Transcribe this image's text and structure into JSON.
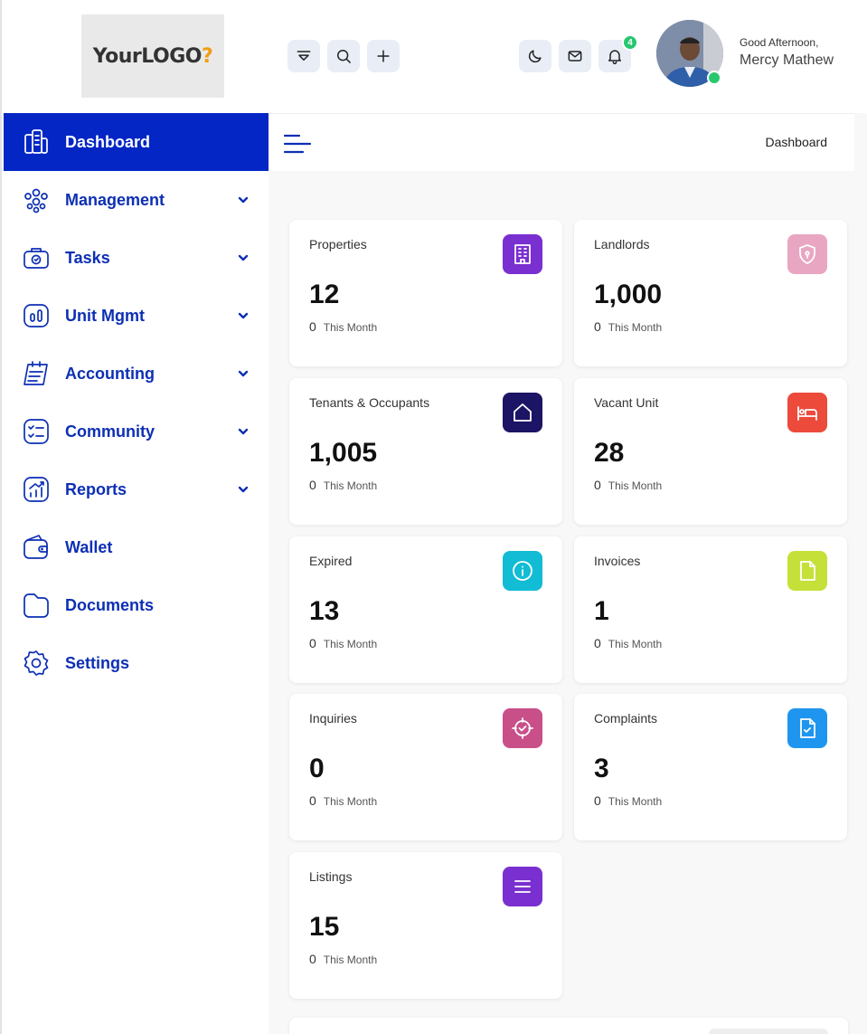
{
  "header": {
    "logo": {
      "part1": "Your",
      "part2": "LOGO",
      "part3": "?"
    },
    "buttons": [
      {
        "name": "filter-icon"
      },
      {
        "name": "search-icon"
      },
      {
        "name": "plus-icon"
      },
      {
        "name": "moon-icon"
      },
      {
        "name": "mail-icon"
      },
      {
        "name": "bell-icon"
      }
    ],
    "notification_count": "4",
    "greeting": "Good Afternoon,",
    "user_name": "Mercy Mathew"
  },
  "sidebar": {
    "items": [
      {
        "label": "Dashboard",
        "icon": "dashboard-icon",
        "active": true,
        "has_children": false
      },
      {
        "label": "Management",
        "icon": "people-icon",
        "active": false,
        "has_children": true
      },
      {
        "label": "Tasks",
        "icon": "briefcase-icon",
        "active": false,
        "has_children": true
      },
      {
        "label": "Unit Mgmt",
        "icon": "unit-icon",
        "active": false,
        "has_children": true
      },
      {
        "label": "Accounting",
        "icon": "ledger-icon",
        "active": false,
        "has_children": true
      },
      {
        "label": "Community",
        "icon": "checklist-icon",
        "active": false,
        "has_children": true
      },
      {
        "label": "Reports",
        "icon": "chart-icon",
        "active": false,
        "has_children": true
      },
      {
        "label": "Wallet",
        "icon": "wallet-icon",
        "active": false,
        "has_children": false
      },
      {
        "label": "Documents",
        "icon": "folder-icon",
        "active": false,
        "has_children": false
      },
      {
        "label": "Settings",
        "icon": "gear-icon",
        "active": false,
        "has_children": false
      }
    ]
  },
  "breadcrumb": "Dashboard",
  "cards": [
    {
      "title": "Properties",
      "value": "12",
      "sub_value": "0",
      "sub_label": "This Month",
      "icon": "building-icon",
      "color": "#7a2fd0"
    },
    {
      "title": "Landlords",
      "value": "1,000",
      "sub_value": "0",
      "sub_label": "This Month",
      "icon": "shield-icon",
      "color": "#e9a6c2"
    },
    {
      "title": "Tenants & Occupants",
      "value": "1,005",
      "sub_value": "0",
      "sub_label": "This Month",
      "icon": "home-icon",
      "color": "#1c1464"
    },
    {
      "title": "Vacant Unit",
      "value": "28",
      "sub_value": "0",
      "sub_label": "This Month",
      "icon": "bed-icon",
      "color": "#ec4a3b"
    },
    {
      "title": "Expired",
      "value": "13",
      "sub_value": "0",
      "sub_label": "This Month",
      "icon": "info-icon",
      "color": "#12bcd4"
    },
    {
      "title": "Invoices",
      "value": "1",
      "sub_value": "0",
      "sub_label": "This Month",
      "icon": "file-icon",
      "color": "#c6e03a"
    },
    {
      "title": "Inquiries",
      "value": "0",
      "sub_value": "0",
      "sub_label": "This Month",
      "icon": "target-icon",
      "color": "#c94f89"
    },
    {
      "title": "Complaints",
      "value": "3",
      "sub_value": "0",
      "sub_label": "This Month",
      "icon": "doc-check-icon",
      "color": "#1e96ef"
    },
    {
      "title": "Listings",
      "value": "15",
      "sub_value": "0",
      "sub_label": "This Month",
      "icon": "list-icon",
      "color": "#7a2fd0"
    }
  ]
}
